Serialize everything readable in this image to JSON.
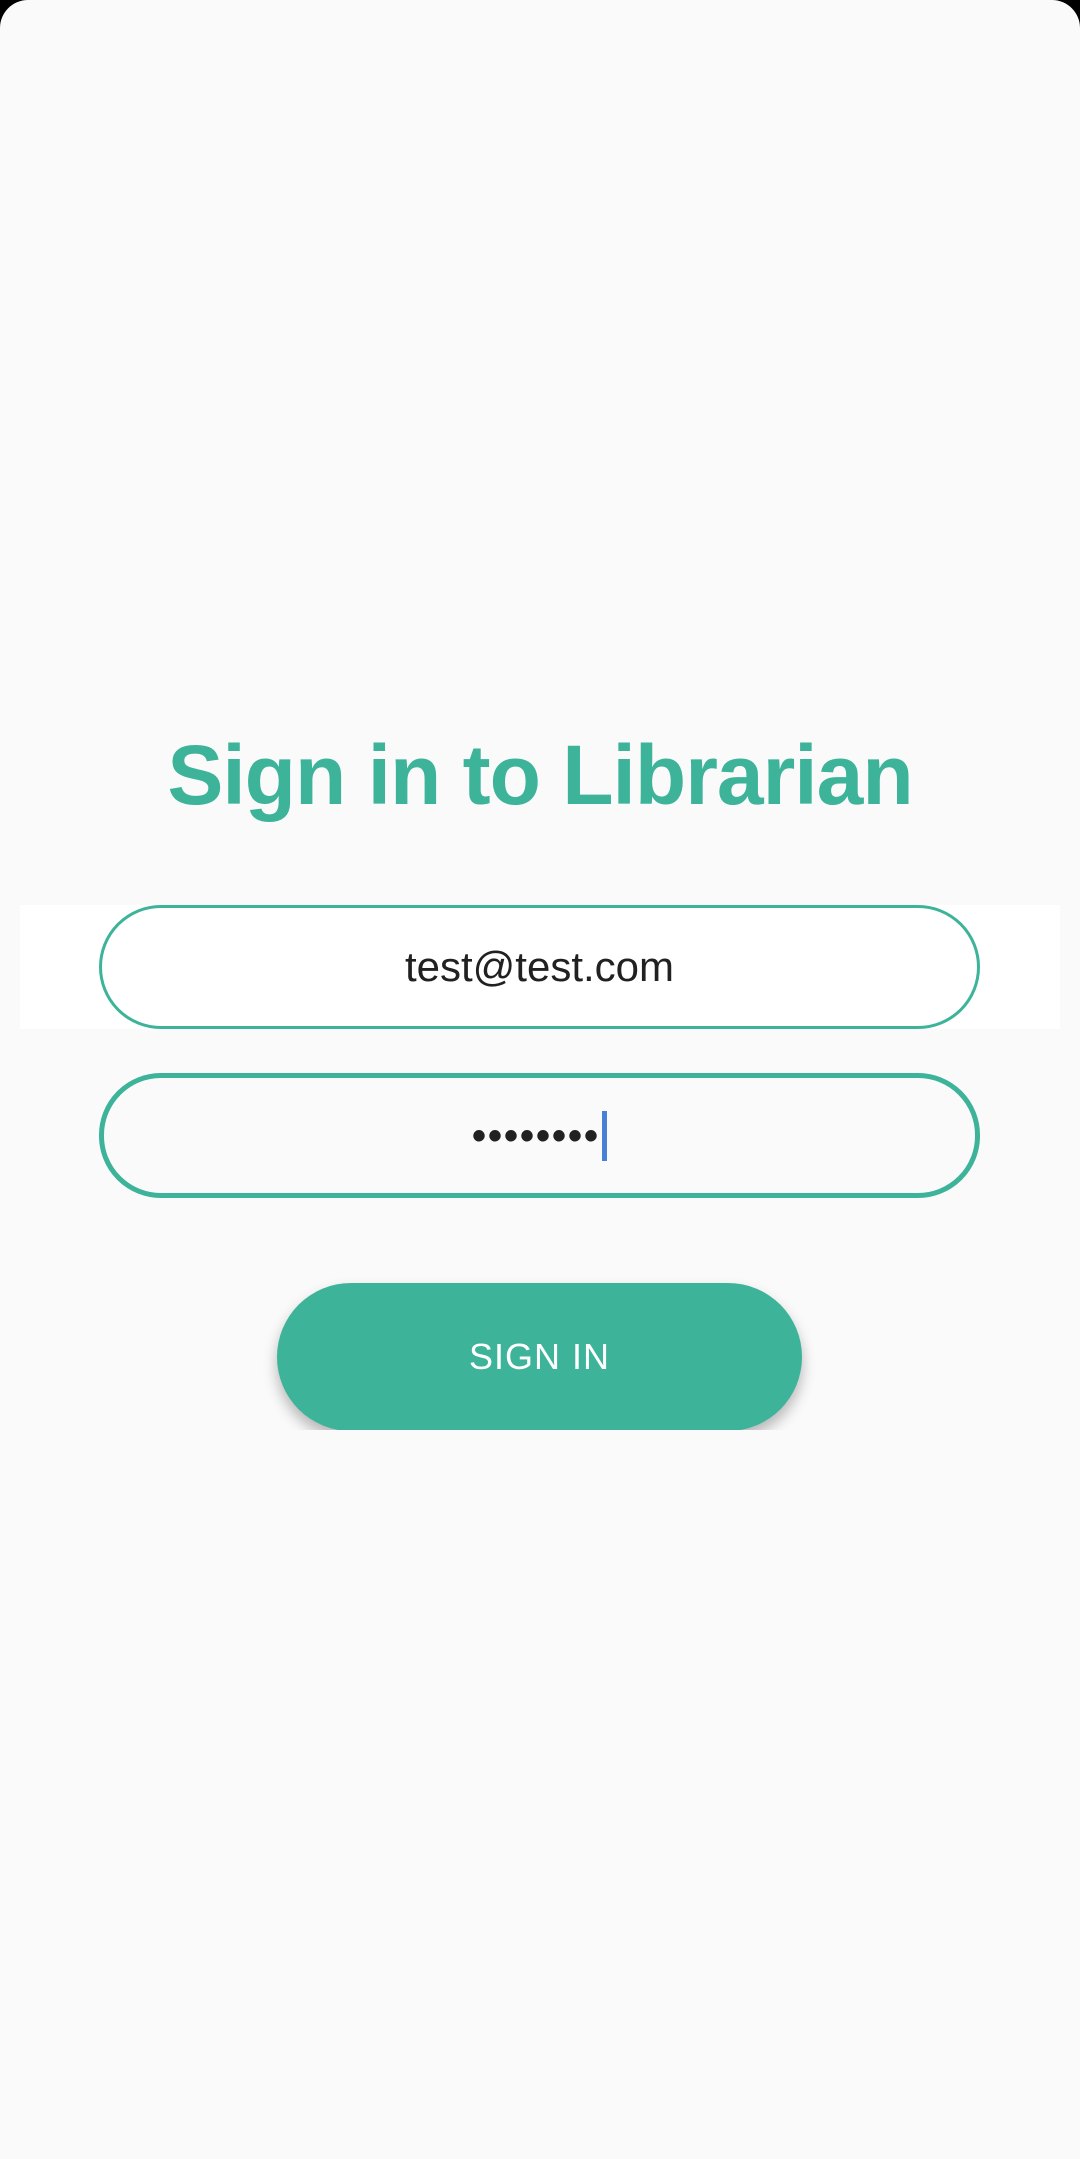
{
  "colors": {
    "accent": "#3db39a",
    "background": "#fafafa",
    "caret": "#4a7fd6",
    "text": "#212121",
    "button_text": "#ffffff"
  },
  "login": {
    "title": "Sign in to Librarian",
    "email_value": "test@test.com",
    "password_masked": "••••••••",
    "signin_label": "SIGN IN"
  }
}
